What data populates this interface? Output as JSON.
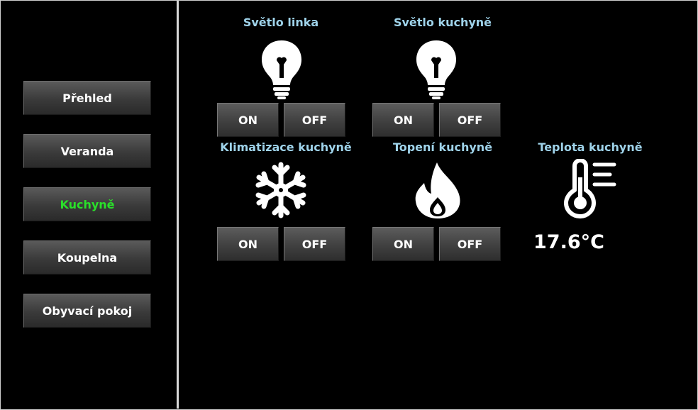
{
  "nav": {
    "items": [
      {
        "label": "Přehled",
        "active": false
      },
      {
        "label": "Veranda",
        "active": false
      },
      {
        "label": "Kuchyně",
        "active": true
      },
      {
        "label": "Koupelna",
        "active": false
      },
      {
        "label": "Obyvací pokoj",
        "active": false
      }
    ],
    "active_color": "#2ae02a"
  },
  "devices": {
    "svetlo_linka": {
      "title": "Světlo linka",
      "icon": "lightbulb-icon",
      "on_label": "ON",
      "off_label": "OFF"
    },
    "svetlo_kuchyne": {
      "title": "Světlo kuchyně",
      "icon": "lightbulb-icon",
      "on_label": "ON",
      "off_label": "OFF"
    },
    "klimatizace": {
      "title": "Klimatizace kuchyně",
      "icon": "snowflake-icon",
      "on_label": "ON",
      "off_label": "OFF"
    },
    "topeni": {
      "title": "Topení kuchyně",
      "icon": "flame-icon",
      "on_label": "ON",
      "off_label": "OFF"
    }
  },
  "teplota": {
    "title": "Teplota kuchyně",
    "icon": "thermometer-icon",
    "value": "17.6°C"
  },
  "colors": {
    "label": "#9fd3ea",
    "background": "#000000",
    "button_text": "#ffffff"
  }
}
